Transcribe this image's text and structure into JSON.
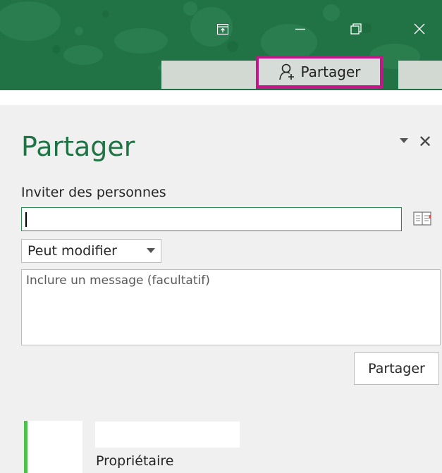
{
  "titlebar": {
    "background_color": "#217346",
    "window_controls": [
      {
        "name": "ribbon-display-options-icon"
      },
      {
        "name": "minimize-icon"
      },
      {
        "name": "restore-icon"
      },
      {
        "name": "close-window-icon"
      }
    ],
    "share_tab": {
      "label": "Partager",
      "icon": "add-person-icon",
      "highlight_color": "#c5158a"
    }
  },
  "pane": {
    "title": "Partager",
    "invite_label": "Inviter des personnes",
    "invite_input_value": "",
    "address_book_icon": "address-book-icon",
    "permission_selected": "Peut modifier",
    "message_placeholder": "Inclure un message (facultatif)",
    "share_button_label": "Partager"
  },
  "owner": {
    "role": "Propriétaire",
    "status_color": "#4cc14c"
  }
}
